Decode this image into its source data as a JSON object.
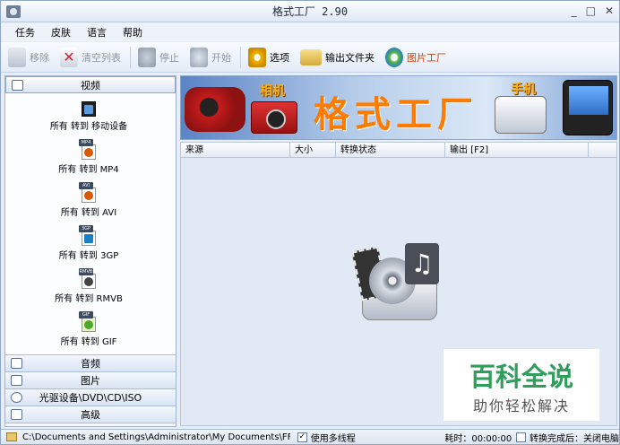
{
  "window": {
    "title": "格式工厂 2.90",
    "minimize": "_",
    "maximize": "□",
    "close": "✕"
  },
  "menu": [
    "任务",
    "皮肤",
    "语言",
    "帮助"
  ],
  "toolbar": [
    {
      "label": "移除",
      "icon": "remove-icon",
      "enabled": false
    },
    {
      "label": "清空列表",
      "icon": "clear-list-icon",
      "enabled": false
    },
    {
      "label": "停止",
      "icon": "stop-icon",
      "enabled": false
    },
    {
      "label": "开始",
      "icon": "start-icon",
      "enabled": false
    },
    {
      "label": "选项",
      "icon": "options-icon",
      "enabled": true
    },
    {
      "label": "输出文件夹",
      "icon": "output-folder-icon",
      "enabled": true
    },
    {
      "label": "图片工厂",
      "icon": "picture-factory-icon",
      "enabled": true,
      "color": "#d43f00"
    }
  ],
  "sidebar": {
    "active_category": "视频",
    "video_items": [
      {
        "label": "所有 转到 移动设备",
        "badge": "",
        "color": "#333333"
      },
      {
        "label": "所有 转到 MP4",
        "badge": "MP4",
        "color": "#d85a00"
      },
      {
        "label": "所有 转到 AVI",
        "badge": "AVI",
        "color": "#d85a00"
      },
      {
        "label": "所有 转到 3GP",
        "badge": "3GP",
        "color": "#1a7fc4"
      },
      {
        "label": "所有 转到 RMVB",
        "badge": "RMVB",
        "color": "#444444"
      },
      {
        "label": "所有 转到 GIF",
        "badge": "GIF",
        "color": "#4da82a"
      }
    ],
    "categories": [
      "音频",
      "图片",
      "光驱设备\\DVD\\CD\\ISO",
      "高级"
    ]
  },
  "banner": {
    "brand": "格式工厂",
    "camera_label": "相机",
    "phone_label": "手机"
  },
  "table": {
    "columns": [
      "来源",
      "大小",
      "转换状态",
      "输出 [F2]"
    ]
  },
  "watermark": {
    "line1": "百科全说",
    "line2": "助你轻松解决"
  },
  "statusbar": {
    "output_path": "C:\\Documents and Settings\\Administrator\\My Documents\\FFOutput",
    "multithread_label": "使用多线程",
    "multithread_checked": true,
    "elapsed": "耗时：00:00:00",
    "after_label": "转换完成后：关闭电脑"
  },
  "colors": {
    "accent": "#ff7b00",
    "panel": "#e1e9f4"
  }
}
